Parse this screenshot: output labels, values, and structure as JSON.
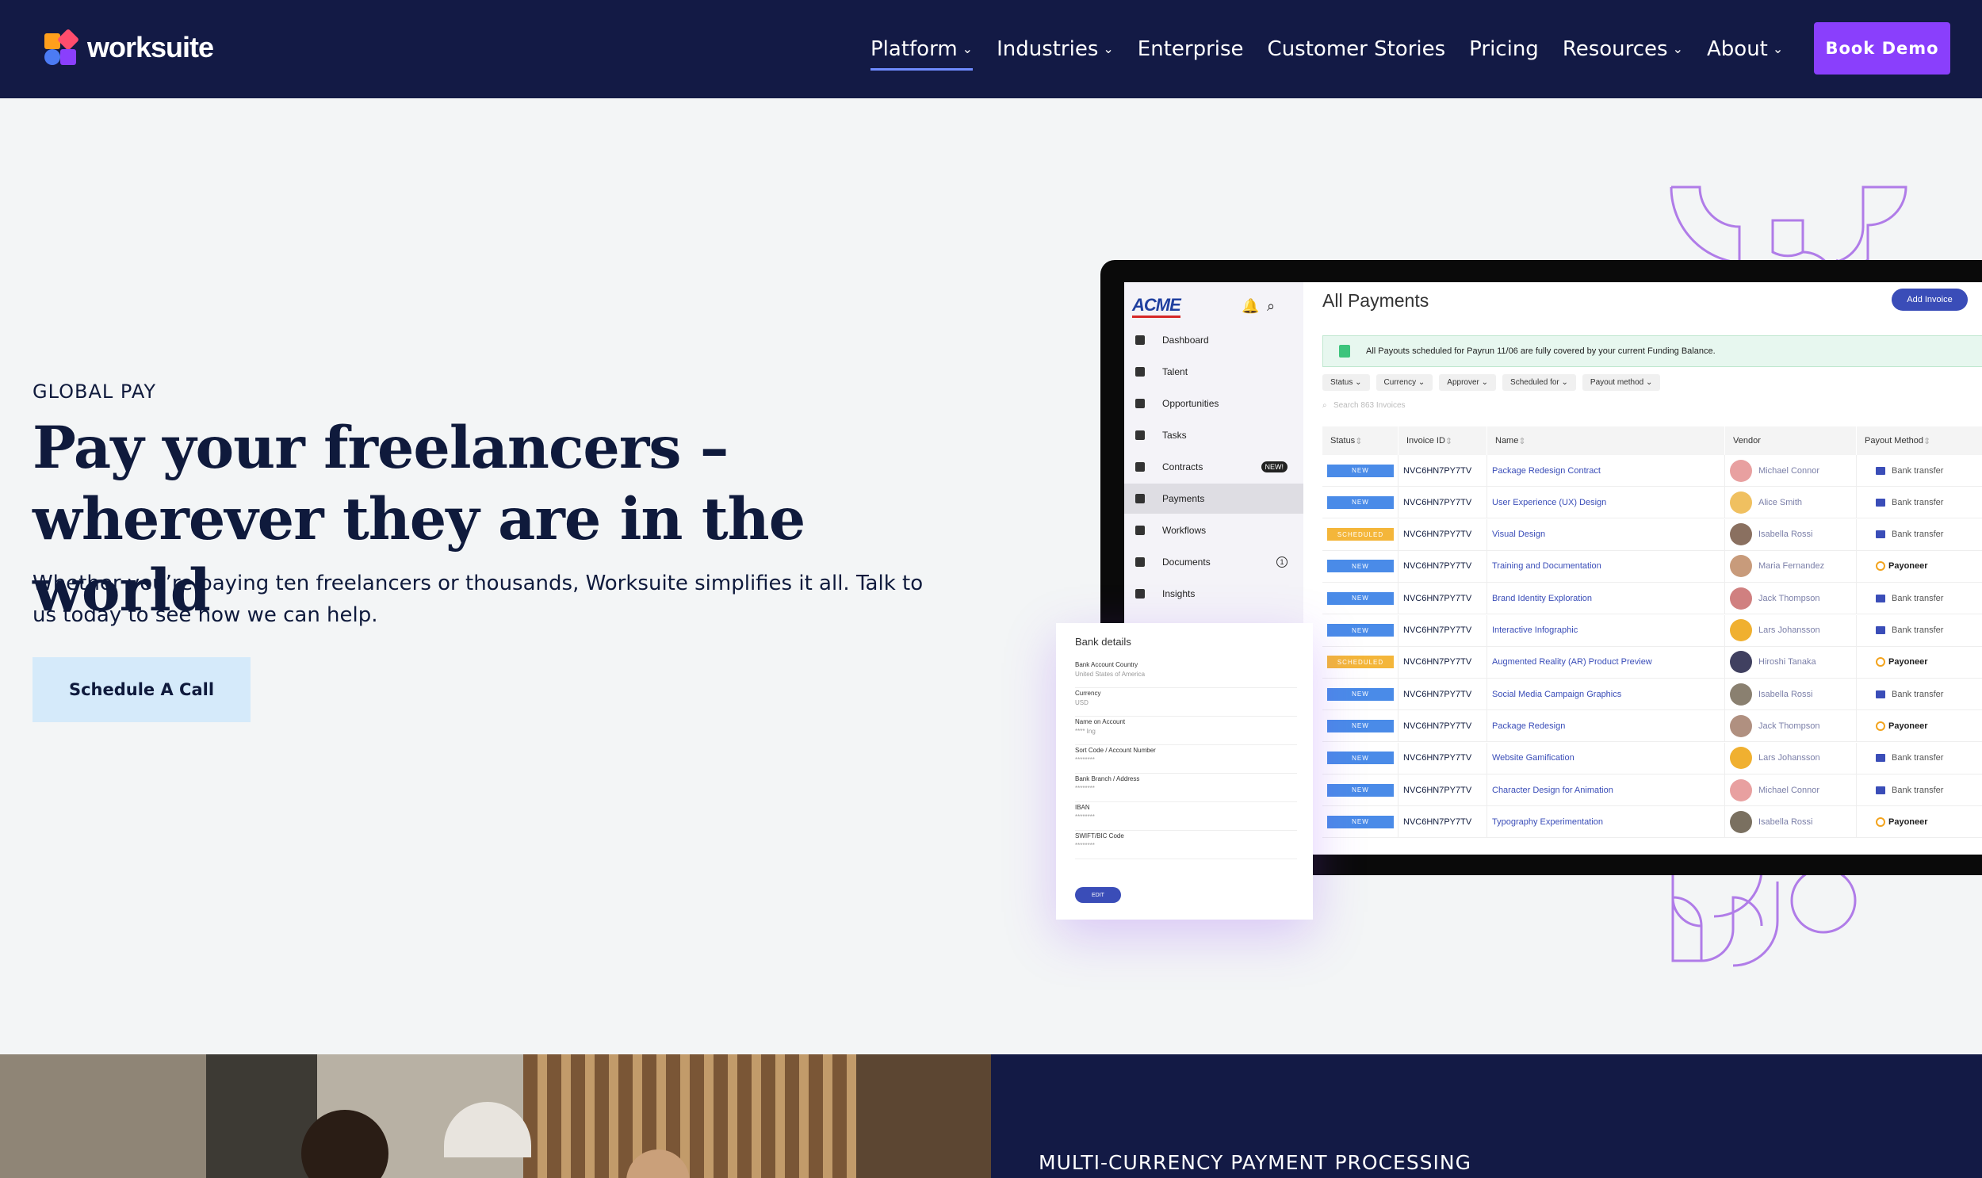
{
  "nav": {
    "brand": "worksuite",
    "items": [
      {
        "label": "Platform",
        "has_menu": true,
        "active": true
      },
      {
        "label": "Industries",
        "has_menu": true
      },
      {
        "label": "Enterprise",
        "has_menu": false
      },
      {
        "label": "Customer Stories",
        "has_menu": false
      },
      {
        "label": "Pricing",
        "has_menu": false
      },
      {
        "label": "Resources",
        "has_menu": true
      },
      {
        "label": "About",
        "has_menu": true
      }
    ],
    "cta": "Book Demo"
  },
  "hero": {
    "eyebrow": "GLOBAL PAY",
    "title_line1": "Pay your freelancers –",
    "title_line2": "wherever they are in the world",
    "subtitle": "Whether you’re paying ten freelancers or thousands, Worksuite simplifies it all. Talk to us today to see how we can help.",
    "cta": "Schedule A Call"
  },
  "app": {
    "logo": "ACME",
    "title": "All Payments",
    "add_invoice": "Add Invoice",
    "sidebar": [
      {
        "label": "Dashboard"
      },
      {
        "label": "Talent"
      },
      {
        "label": "Opportunities"
      },
      {
        "label": "Tasks"
      },
      {
        "label": "Contracts",
        "badge": "NEW!"
      },
      {
        "label": "Payments",
        "selected": true
      },
      {
        "label": "Workflows"
      },
      {
        "label": "Documents",
        "count": "1"
      },
      {
        "label": "Insights"
      }
    ],
    "banner": "All Payouts scheduled for Payrun 11/06 are fully covered by your current Funding Balance.",
    "filters": [
      "Status",
      "Currency",
      "Approver",
      "Scheduled for",
      "Payout method"
    ],
    "search_placeholder": "Search 863 Invoices",
    "columns": [
      "Status",
      "Invoice ID",
      "Name",
      "Vendor",
      "Payout Method"
    ],
    "rows": [
      {
        "status": "NEW",
        "id": "NVC6HN7PY7TV",
        "name": "Package Redesign Contract",
        "vendor": "Michael Connor",
        "method": "Bank transfer"
      },
      {
        "status": "NEW",
        "id": "NVC6HN7PY7TV",
        "name": "User Experience (UX) Design",
        "vendor": "Alice Smith",
        "method": "Bank transfer"
      },
      {
        "status": "SCHEDULED",
        "id": "NVC6HN7PY7TV",
        "name": "Visual Design",
        "vendor": "Isabella Rossi",
        "method": "Bank transfer"
      },
      {
        "status": "NEW",
        "id": "NVC6HN7PY7TV",
        "name": "Training and Documentation",
        "vendor": "Maria Fernandez",
        "method": "Payoneer"
      },
      {
        "status": "NEW",
        "id": "NVC6HN7PY7TV",
        "name": "Brand Identity Exploration",
        "vendor": "Jack Thompson",
        "method": "Bank transfer"
      },
      {
        "status": "NEW",
        "id": "NVC6HN7PY7TV",
        "name": "Interactive Infographic",
        "vendor": "Lars Johansson",
        "method": "Bank transfer"
      },
      {
        "status": "SCHEDULED",
        "id": "NVC6HN7PY7TV",
        "name": "Augmented Reality (AR) Product Preview",
        "vendor": "Hiroshi Tanaka",
        "method": "Payoneer"
      },
      {
        "status": "NEW",
        "id": "NVC6HN7PY7TV",
        "name": "Social Media Campaign Graphics",
        "vendor": "Isabella Rossi",
        "method": "Bank transfer"
      },
      {
        "status": "NEW",
        "id": "NVC6HN7PY7TV",
        "name": "Package Redesign",
        "vendor": "Jack Thompson",
        "method": "Payoneer"
      },
      {
        "status": "NEW",
        "id": "NVC6HN7PY7TV",
        "name": "Website Gamification",
        "vendor": "Lars Johansson",
        "method": "Bank transfer"
      },
      {
        "status": "NEW",
        "id": "NVC6HN7PY7TV",
        "name": "Character Design for Animation",
        "vendor": "Michael Connor",
        "method": "Bank transfer"
      },
      {
        "status": "NEW",
        "id": "NVC6HN7PY7TV",
        "name": "Typography Experimentation",
        "vendor": "Isabella Rossi",
        "method": "Payoneer"
      }
    ]
  },
  "bank_card": {
    "title": "Bank details",
    "fields": [
      {
        "label": "Bank Account Country",
        "value": "United States of America"
      },
      {
        "label": "Currency",
        "value": "USD"
      },
      {
        "label": "Name on Account",
        "value": "**** Ing"
      },
      {
        "label": "Sort Code / Account Number",
        "value": "********"
      },
      {
        "label": "Bank Branch / Address",
        "value": "********"
      },
      {
        "label": "IBAN",
        "value": "********"
      },
      {
        "label": "SWIFT/BIC Code",
        "value": "********"
      }
    ],
    "edit": "EDIT"
  },
  "lower": {
    "eyebrow": "MULTI-CURRENCY PAYMENT PROCESSING"
  },
  "colors": {
    "nav_bg": "#131a45",
    "accent": "#8a3ffc",
    "cta_light": "#d5eafa",
    "app_blue": "#3a4db8"
  }
}
